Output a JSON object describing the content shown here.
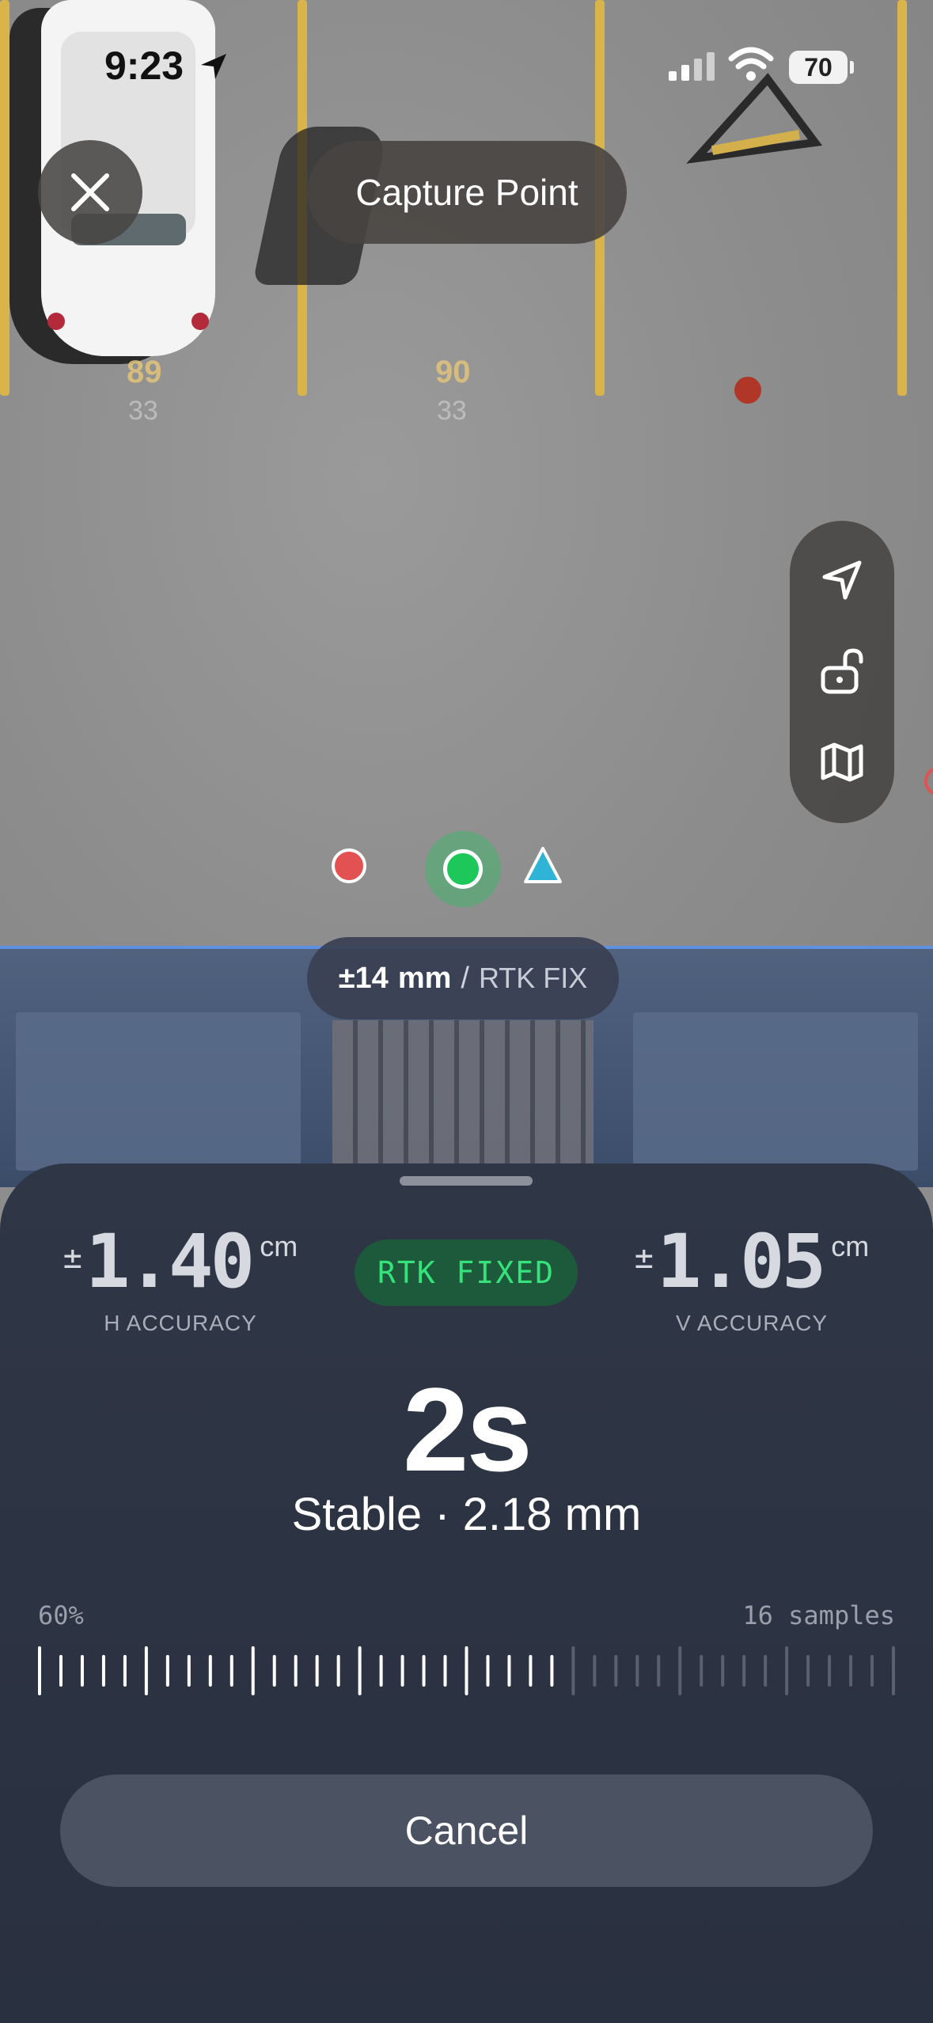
{
  "status_bar": {
    "time": "9:23",
    "battery": "70",
    "icons": [
      "location-arrow-icon",
      "signal-icon",
      "wifi-icon",
      "battery-icon"
    ]
  },
  "header": {
    "title": "Capture Point",
    "close_icon": "close-icon"
  },
  "map": {
    "stall_labels": [
      "89",
      "90"
    ],
    "stall_sublabels": [
      "33",
      "33"
    ],
    "side_controls": [
      "navigation-arrow-icon",
      "unlock-icon",
      "map-icon"
    ],
    "markers": [
      "red-point-marker",
      "green-current-position-marker",
      "blue-triangle-marker"
    ]
  },
  "accuracy_pill": {
    "value": "±14",
    "unit": "mm",
    "separator": "/",
    "fix": "RTK FIX"
  },
  "sheet": {
    "h_accuracy": {
      "pm": "±",
      "value": "1.40",
      "unit": "cm",
      "label": "H ACCURACY"
    },
    "v_accuracy": {
      "pm": "±",
      "value": "1.05",
      "unit": "cm",
      "label": "V ACCURACY"
    },
    "fix_badge": "RTK FIXED",
    "countdown": "2s",
    "stability": "Stable · 2.18 mm",
    "progress_percent": "60%",
    "progress_fraction": 0.6,
    "samples": "16 samples",
    "cancel_label": "Cancel"
  },
  "colors": {
    "accent_green": "#35e37a",
    "badge_green_bg": "#1d5a3b",
    "sheet_bg": "#2f3646",
    "marker_red": "#e25252",
    "marker_green": "#1ec75a",
    "marker_blue": "#2fb3d6"
  }
}
